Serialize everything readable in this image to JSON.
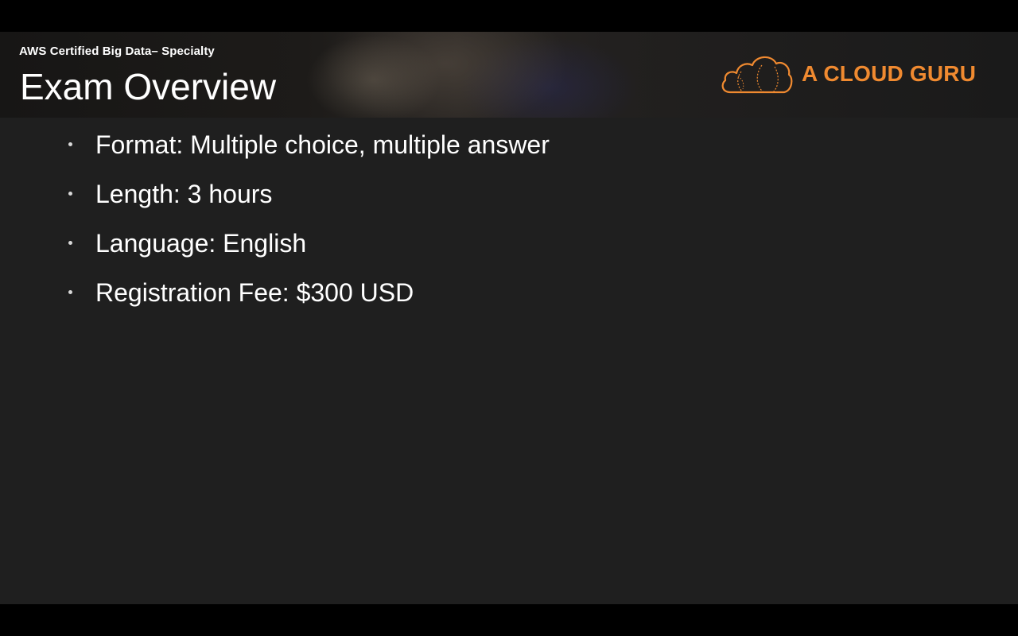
{
  "slide": {
    "subtitle": "AWS Certified Big Data– Specialty",
    "title": "Exam Overview",
    "logo": {
      "text": "A CLOUD GURU",
      "icon": "cloud-icon",
      "color": "#f08a30"
    },
    "bullets": [
      {
        "text": "Format: Multiple choice, multiple answer"
      },
      {
        "text": "Length: 3 hours"
      },
      {
        "text": "Language: English"
      },
      {
        "text": "Registration Fee: $300 USD"
      }
    ]
  },
  "colors": {
    "background": "#1f1f1f",
    "letterbox": "#000000",
    "text": "#ffffff",
    "accent": "#f08a30"
  }
}
